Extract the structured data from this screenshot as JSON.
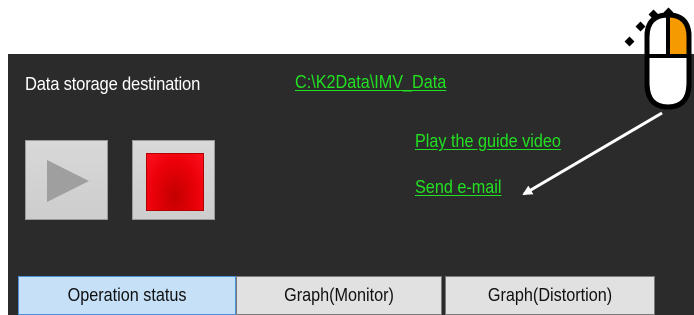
{
  "storage": {
    "label": "Data storage destination",
    "path": "C:\\K2Data\\IMV_Data"
  },
  "links": {
    "guide_video": "Play the guide video",
    "send_email": "Send e-mail"
  },
  "controls": {
    "play_icon": "play-icon",
    "stop_icon": "stop-icon"
  },
  "tabs": [
    {
      "label": "Operation status",
      "selected": true
    },
    {
      "label": "Graph(Monitor)",
      "selected": false
    },
    {
      "label": "Graph(Distortion)",
      "selected": false
    }
  ],
  "annotation": {
    "pointer_icon": "mouse-click-icon",
    "pointer_color": "#f59a00"
  },
  "colors": {
    "panel_background": "#2b2b2b",
    "link_green": "#22e022",
    "stop_red": "#ea0008",
    "selected_tab": "#c6e0f8"
  }
}
